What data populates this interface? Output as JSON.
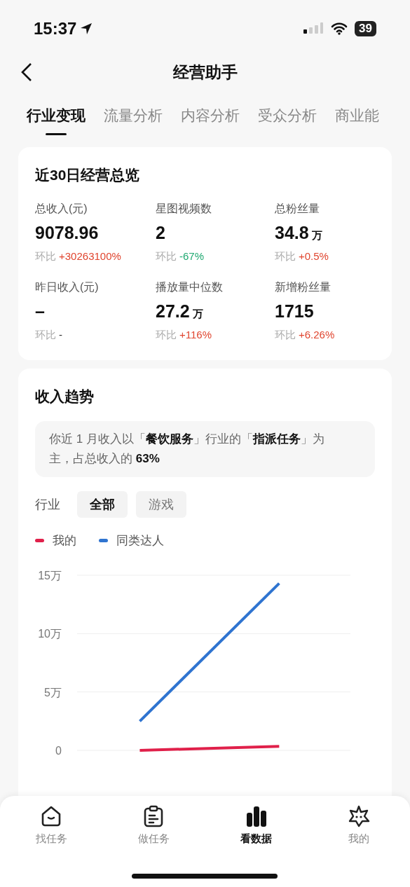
{
  "status_bar": {
    "time": "15:37",
    "battery": "39"
  },
  "header": {
    "title": "经营助手"
  },
  "tabs": [
    {
      "label": "行业变现",
      "selected": true
    },
    {
      "label": "流量分析",
      "selected": false
    },
    {
      "label": "内容分析",
      "selected": false
    },
    {
      "label": "受众分析",
      "selected": false
    },
    {
      "label": "商业能",
      "selected": false
    }
  ],
  "overview": {
    "title": "近30日经营总览",
    "metrics": [
      {
        "label": "总收入(元)",
        "value": "9078.96",
        "compare_label": "环比",
        "change": "+30263100%",
        "color": "#e0452f"
      },
      {
        "label": "星图视频数",
        "value": "2",
        "compare_label": "环比",
        "change": "-67%",
        "color": "#1fa971"
      },
      {
        "label": "总粉丝量",
        "value": "34.8",
        "unit": "万",
        "compare_label": "环比",
        "change": "+0.5%",
        "color": "#e0452f"
      },
      {
        "label": "昨日收入(元)",
        "value": "–",
        "compare_label": "环比",
        "change": "-",
        "color": "#333333"
      },
      {
        "label": "播放量中位数",
        "value": "27.2",
        "unit": "万",
        "compare_label": "环比",
        "change": "+116%",
        "color": "#e0452f"
      },
      {
        "label": "新增粉丝量",
        "value": "1715",
        "compare_label": "环比",
        "change": "+6.26%",
        "color": "#e0452f"
      }
    ]
  },
  "income_trend": {
    "title": "收入趋势",
    "summary": "你近 1 月收入以「**餐饮服务**」行业的「**指派任务**」为主，占总收入的 **63%**",
    "filter_label": "行业",
    "filters": [
      {
        "label": "全部",
        "selected": true
      },
      {
        "label": "游戏",
        "selected": false
      }
    ],
    "chart_data": {
      "type": "line",
      "ylim": [
        0,
        15
      ],
      "yticks": [
        {
          "value": 0,
          "label": "0"
        },
        {
          "value": 5,
          "label": "5万"
        },
        {
          "value": 10,
          "label": "10万"
        },
        {
          "value": 15,
          "label": "15万"
        }
      ],
      "series": [
        {
          "name": "我的",
          "color": "#e0204a",
          "values": [
            0,
            0.35
          ]
        },
        {
          "name": "同类达人",
          "color": "#2f74d0",
          "values": [
            2.5,
            14.3
          ]
        }
      ]
    }
  },
  "bottom_nav": [
    {
      "label": "找任务",
      "kind": "home",
      "selected": false
    },
    {
      "label": "做任务",
      "kind": "clipboard",
      "selected": false
    },
    {
      "label": "看数据",
      "kind": "chart",
      "selected": true
    },
    {
      "label": "我的",
      "kind": "star",
      "selected": false
    }
  ]
}
